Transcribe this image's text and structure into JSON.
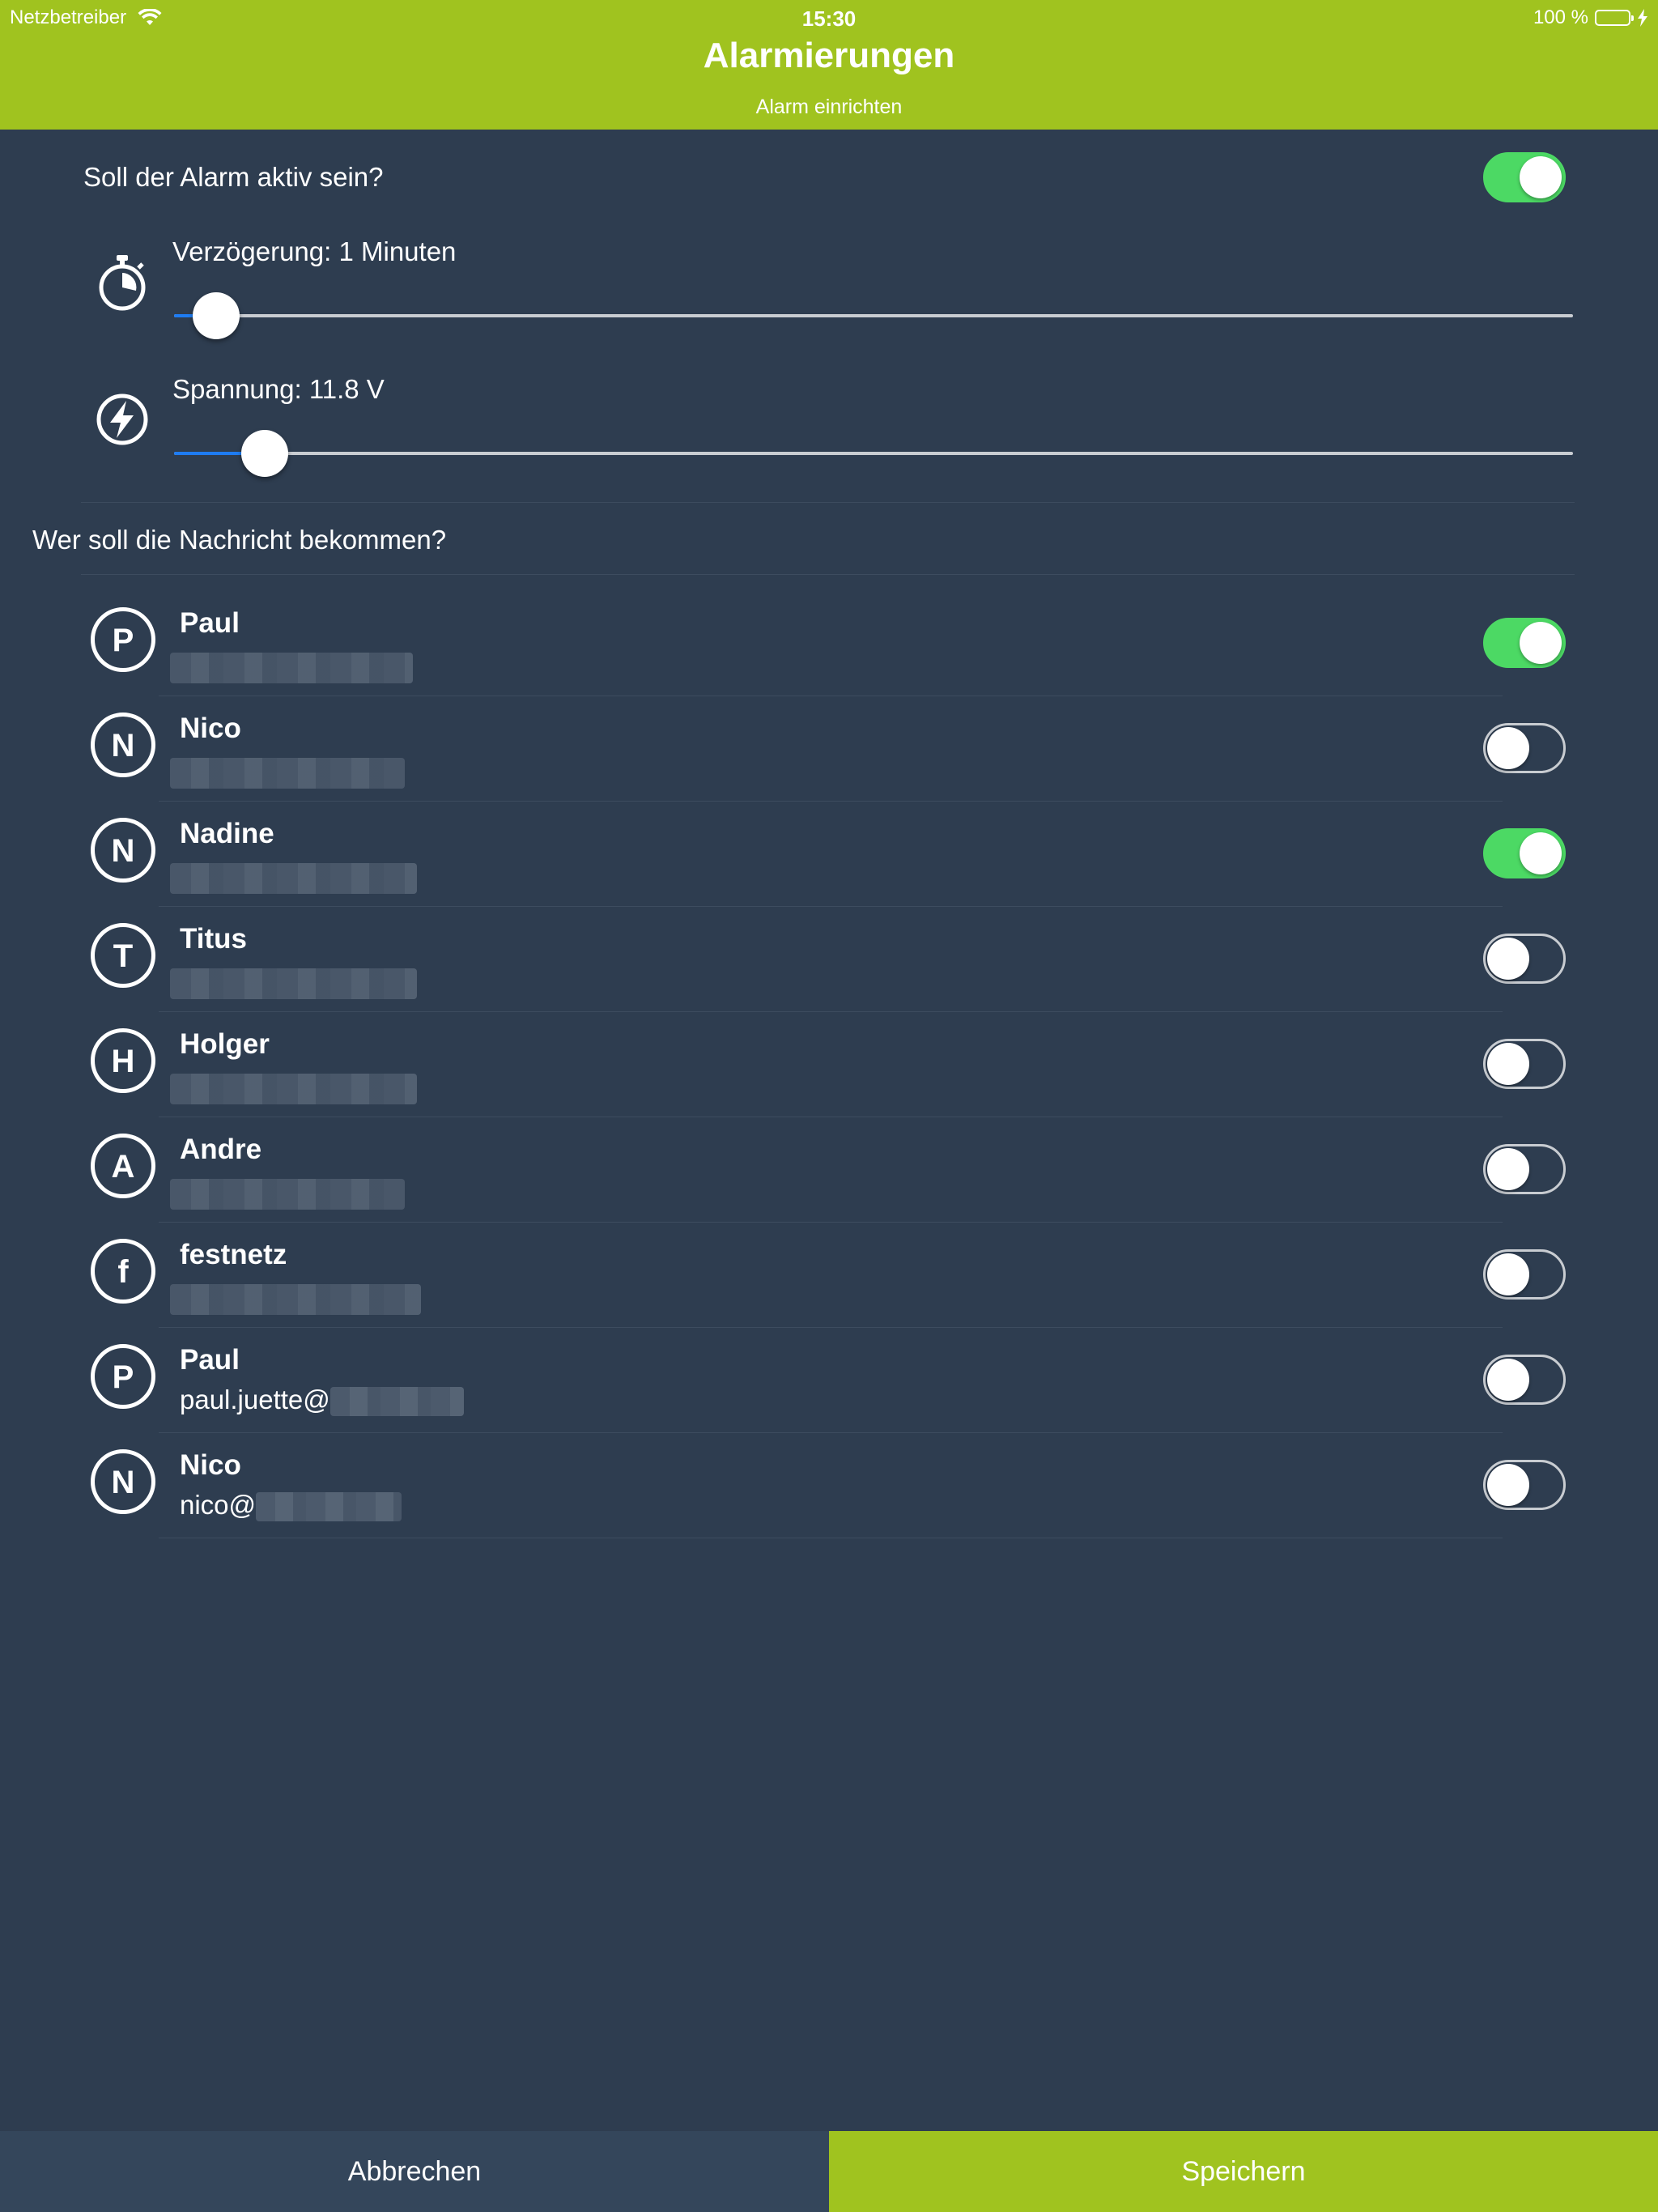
{
  "status_bar": {
    "carrier": "Netzbetreiber",
    "time": "15:30",
    "battery": "100 %"
  },
  "header": {
    "title": "Alarmierungen",
    "subtitle": "Alarm einrichten"
  },
  "alarm": {
    "active_label": "Soll der Alarm aktiv sein?",
    "active": true,
    "delay_label": "Verzögerung: 1 Minuten",
    "delay_fraction": 0.03,
    "voltage_label": "Spannung: 11.8 V",
    "voltage_fraction": 0.065
  },
  "recipients_label": "Wer soll die Nachricht bekommen?",
  "contacts": [
    {
      "initial": "P",
      "name": "Paul",
      "detail": "",
      "enabled": true
    },
    {
      "initial": "N",
      "name": "Nico",
      "detail": "",
      "enabled": false
    },
    {
      "initial": "N",
      "name": "Nadine",
      "detail": "",
      "enabled": true
    },
    {
      "initial": "T",
      "name": "Titus",
      "detail": "",
      "enabled": false
    },
    {
      "initial": "H",
      "name": "Holger",
      "detail": "",
      "enabled": false
    },
    {
      "initial": "A",
      "name": "Andre",
      "detail": "",
      "enabled": false
    },
    {
      "initial": "f",
      "name": "festnetz",
      "detail": "",
      "enabled": false
    },
    {
      "initial": "P",
      "name": "Paul",
      "detail": "paul.juette@",
      "enabled": false
    },
    {
      "initial": "N",
      "name": "Nico",
      "detail": "nico@",
      "enabled": false
    }
  ],
  "footer": {
    "cancel_label": "Abbrechen",
    "save_label": "Speichern"
  },
  "colors": {
    "accent": "#a0c31f",
    "background": "#2e3d50",
    "toggle_on": "#4cd964",
    "slider_fill": "#1e7cf2"
  }
}
